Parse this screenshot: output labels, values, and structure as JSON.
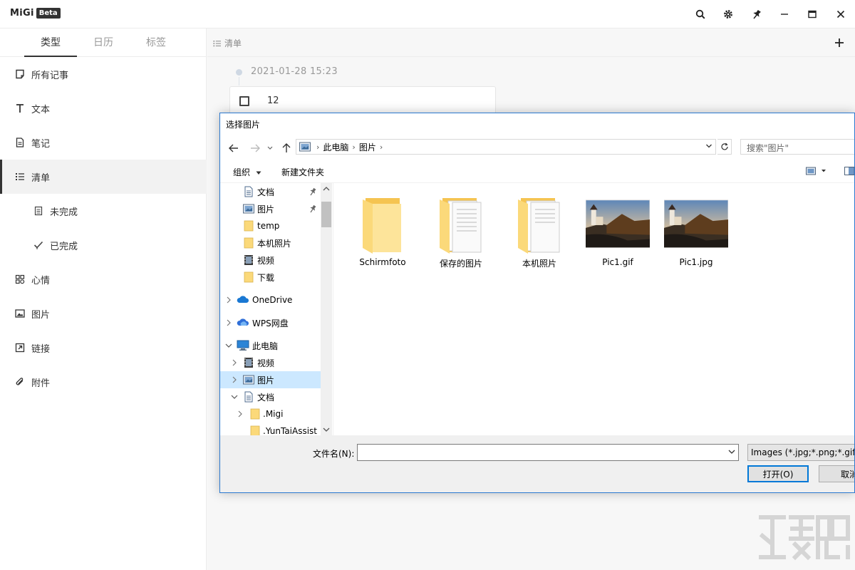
{
  "app": {
    "logo": "MiGi",
    "badge": "Beta"
  },
  "titlebar": {
    "icons": [
      "search-icon",
      "gear-icon",
      "pin-icon",
      "minimize-icon",
      "maximize-icon",
      "close-icon"
    ]
  },
  "sidebar": {
    "tabs": [
      {
        "label": "类型",
        "active": true
      },
      {
        "label": "日历",
        "active": false
      },
      {
        "label": "标签",
        "active": false
      }
    ],
    "items": [
      {
        "label": "所有记事",
        "icon": "note-icon"
      },
      {
        "label": "文本",
        "icon": "text-icon"
      },
      {
        "label": "笔记",
        "icon": "document-icon"
      },
      {
        "label": "清单",
        "icon": "list-icon",
        "active": true
      },
      {
        "label": "未完成",
        "icon": "pending-icon",
        "sub": true
      },
      {
        "label": "已完成",
        "icon": "check-icon",
        "sub": true
      },
      {
        "label": "心情",
        "icon": "mood-icon"
      },
      {
        "label": "图片",
        "icon": "image-icon"
      },
      {
        "label": "链接",
        "icon": "link-icon"
      },
      {
        "label": "附件",
        "icon": "paperclip-icon"
      }
    ]
  },
  "main": {
    "breadcrumb": "清单",
    "timestamp": "2021-01-28 15:23",
    "task": {
      "text": "12",
      "checked": false
    }
  },
  "dialog": {
    "title": "选择图片",
    "address": [
      "此电脑",
      "图片"
    ],
    "search_placeholder": "搜索\"图片\"",
    "commands": {
      "organize": "组织",
      "new_folder": "新建文件夹"
    },
    "tree": [
      {
        "label": "文档",
        "icon": "document-icon",
        "pinned": true
      },
      {
        "label": "图片",
        "icon": "picture-library-icon",
        "pinned": true
      },
      {
        "label": "temp",
        "icon": "folder-icon"
      },
      {
        "label": "本机照片",
        "icon": "folder-icon"
      },
      {
        "label": "视频",
        "icon": "video-icon"
      },
      {
        "label": "下载",
        "icon": "folder-icon"
      },
      {
        "label": "OneDrive",
        "icon": "cloud-icon"
      },
      {
        "label": "WPS网盘",
        "icon": "cloud-icon"
      },
      {
        "label": "此电脑",
        "icon": "computer-icon"
      },
      {
        "label": "视频",
        "icon": "video-icon"
      },
      {
        "label": "图片",
        "icon": "picture-library-icon",
        "selected": true
      },
      {
        "label": "文档",
        "icon": "document-icon"
      },
      {
        "label": ".Migi",
        "icon": "folder-icon"
      },
      {
        "label": ".YunTaiAssist",
        "icon": "folder-icon"
      }
    ],
    "files": [
      {
        "name": "Schirmfoto",
        "type": "folder"
      },
      {
        "name": "保存的图片",
        "type": "folder-docs"
      },
      {
        "name": "本机照片",
        "type": "folder-docs"
      },
      {
        "name": "Pic1.gif",
        "type": "image"
      },
      {
        "name": "Pic1.jpg",
        "type": "image"
      }
    ],
    "filename_label": "文件名(N):",
    "filename_value": "",
    "type_filter": "Images (*.jpg;*.png;*.gif;*.",
    "open_button": "打开(O)",
    "cancel_button": "取消"
  },
  "colors": {
    "accent": "#0078d7",
    "selection": "#cce8ff",
    "sidebar_active": "#f2f2f2"
  }
}
